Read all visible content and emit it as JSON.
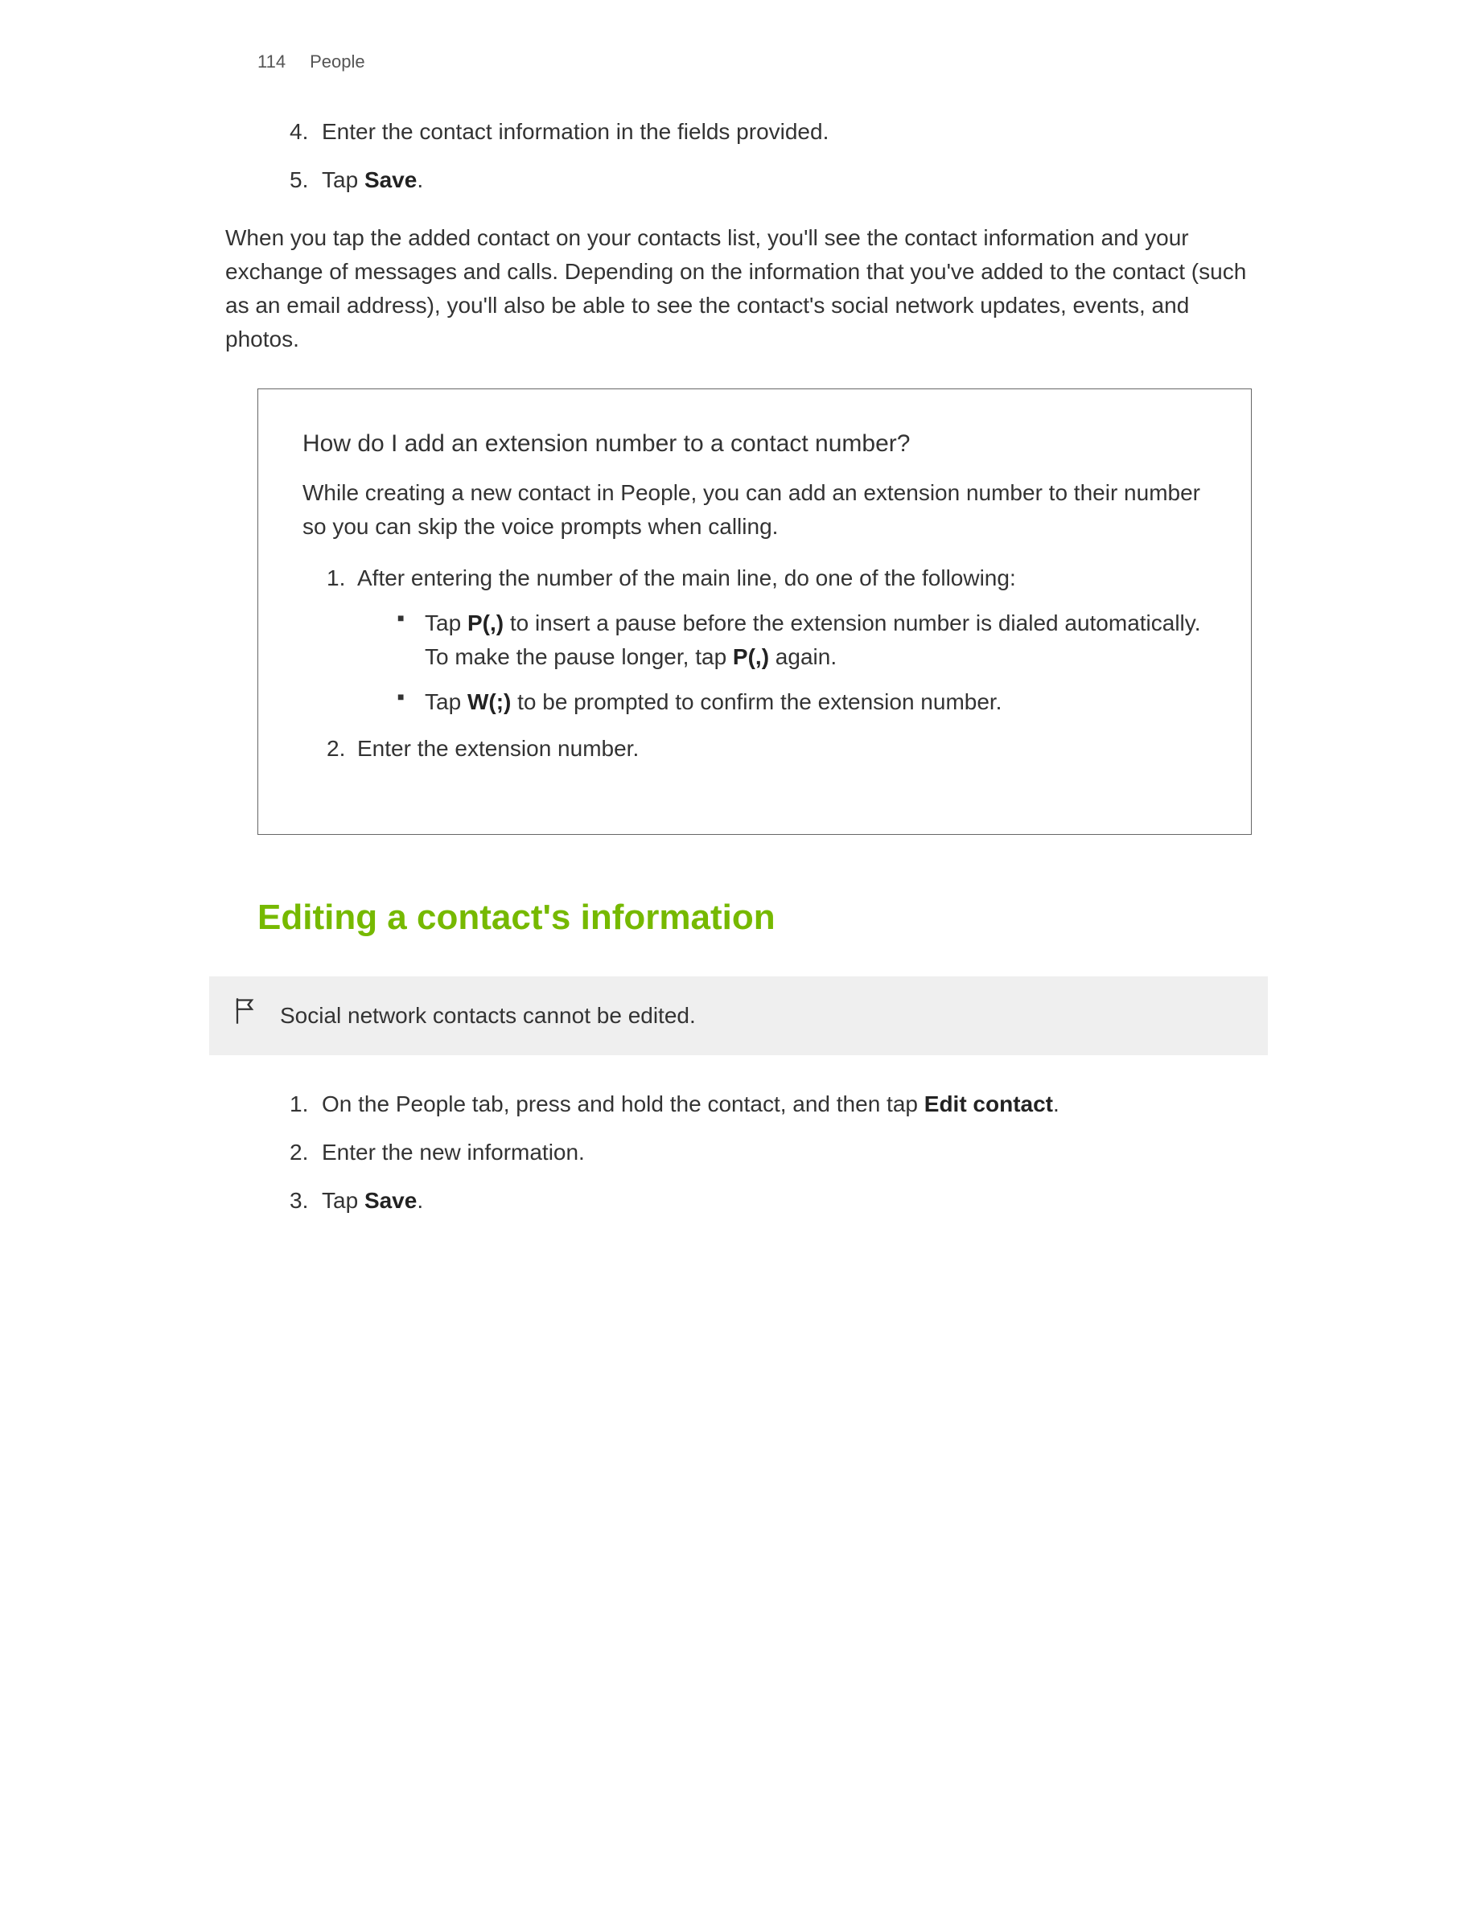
{
  "header": {
    "page_number": "114",
    "section": "People"
  },
  "top_list": {
    "items": [
      {
        "num": "4.",
        "text_before": "Enter the contact information in the fields provided."
      },
      {
        "num": "5.",
        "text_before": "Tap ",
        "bold": "Save",
        "text_after": "."
      }
    ]
  },
  "intro_para": "When you tap the added contact on your contacts list, you'll see the contact information and your exchange of messages and calls. Depending on the information that you've added to the contact (such as an email address), you'll also be able to see the contact's social network updates, events, and photos.",
  "box": {
    "title": "How do I add an extension number to a contact number?",
    "para": "While creating a new contact in People, you can add an extension number to their number so you can skip the voice prompts when calling.",
    "step1": {
      "num": "1.",
      "text": "After entering the number of the main line, do one of the following:",
      "bullets": [
        {
          "t1": "Tap ",
          "b1": "P(,)",
          "t2": " to insert a pause before the extension number is dialed automatically. To make the pause longer, tap ",
          "b2": "P(,)",
          "t3": " again."
        },
        {
          "t1": "Tap ",
          "b1": "W(;)",
          "t2": " to be prompted to confirm the extension number."
        }
      ]
    },
    "step2": {
      "num": "2.",
      "text": "Enter the extension number."
    }
  },
  "heading": "Editing a contact's information",
  "note": "Social network contacts cannot be edited.",
  "steps": {
    "s1": {
      "num": "1.",
      "t1": "On the People tab, press and hold the contact, and then tap ",
      "b": "Edit contact",
      "t2": "."
    },
    "s2": {
      "num": "2.",
      "text": "Enter the new information."
    },
    "s3": {
      "num": "3.",
      "t1": "Tap ",
      "b": "Save",
      "t2": "."
    }
  }
}
